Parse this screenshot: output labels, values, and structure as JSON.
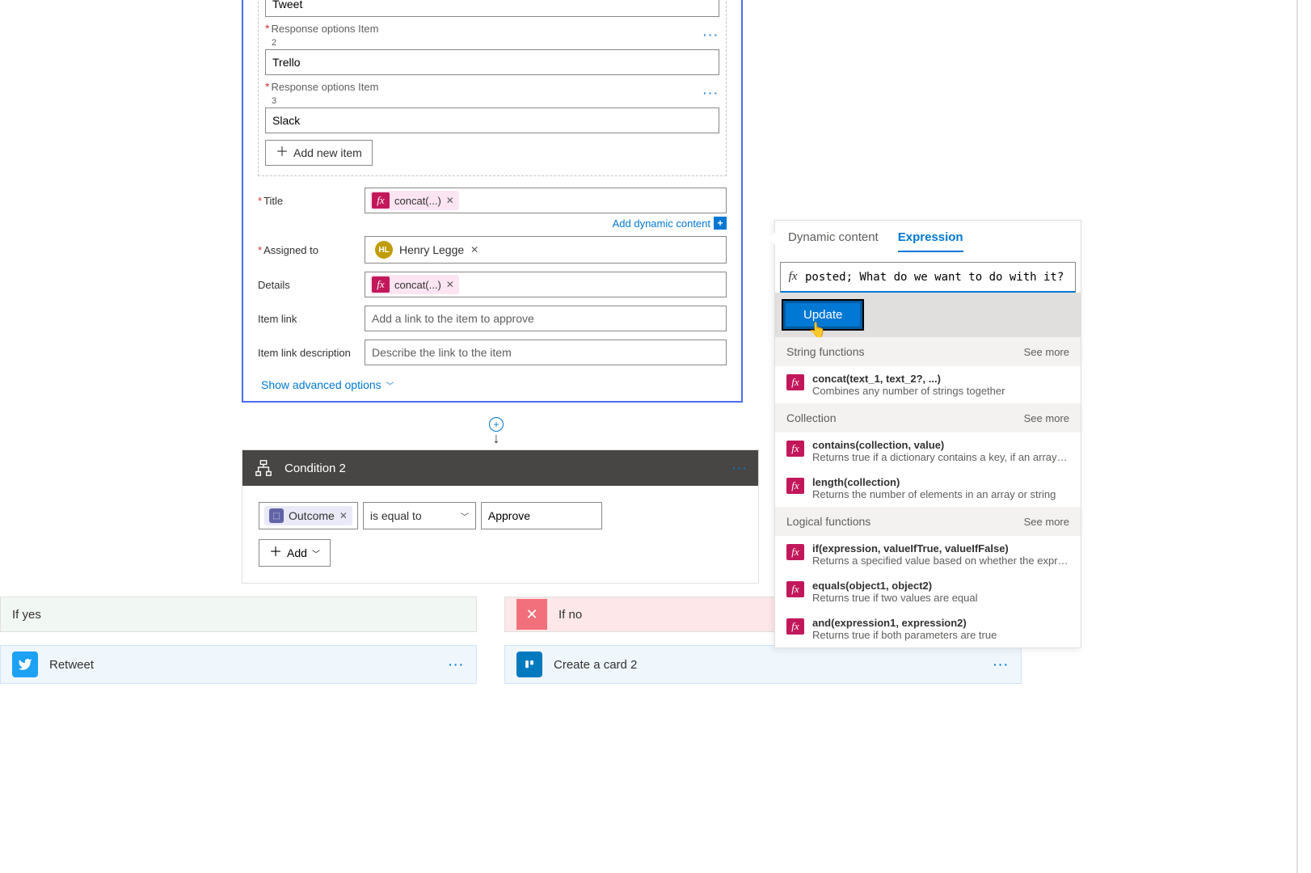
{
  "responseItems": [
    {
      "label": "Response options Item",
      "value": "Tweet"
    },
    {
      "label": "Response options Item",
      "num": "2",
      "value": "Trello"
    },
    {
      "label": "Response options Item",
      "num": "3",
      "value": "Slack"
    }
  ],
  "addNewItem": "Add new item",
  "fields": {
    "titleLabel": "Title",
    "titlePill": "concat(...)",
    "addDynamic": "Add dynamic content",
    "assignedLabel": "Assigned to",
    "assignedInitials": "HL",
    "assignedName": "Henry Legge",
    "detailsLabel": "Details",
    "detailsPill": "concat(...)",
    "itemLinkLabel": "Item link",
    "itemLinkPlaceholder": "Add a link to the item to approve",
    "itemLinkDescLabel": "Item link description",
    "itemLinkDescPlaceholder": "Describe the link to the item",
    "showAdvanced": "Show advanced options"
  },
  "condition": {
    "title": "Condition 2",
    "outcome": "Outcome",
    "operator": "is equal to",
    "compare": "Approve",
    "add": "Add"
  },
  "branches": {
    "yesLabel": "If yes",
    "noLabel": "If no",
    "yesAction": "Retweet",
    "noAction": "Create a card 2"
  },
  "expr": {
    "tabDyn": "Dynamic content",
    "tabExpr": "Expression",
    "fxLabel": "fx",
    "input": "posted; What do we want to do with it?",
    "update": "Update",
    "seeMore": "See more",
    "categories": [
      {
        "name": "String functions",
        "fns": [
          {
            "sig": "concat(text_1, text_2?, ...)",
            "desc": "Combines any number of strings together"
          }
        ]
      },
      {
        "name": "Collection",
        "fns": [
          {
            "sig": "contains(collection, value)",
            "desc": "Returns true if a dictionary contains a key, if an array cont.."
          },
          {
            "sig": "length(collection)",
            "desc": "Returns the number of elements in an array or string"
          }
        ]
      },
      {
        "name": "Logical functions",
        "fns": [
          {
            "sig": "if(expression, valueIfTrue, valueIfFalse)",
            "desc": "Returns a specified value based on whether the expressio.."
          },
          {
            "sig": "equals(object1, object2)",
            "desc": "Returns true if two values are equal"
          },
          {
            "sig": "and(expression1, expression2)",
            "desc": "Returns true if both parameters are true"
          }
        ]
      }
    ]
  }
}
